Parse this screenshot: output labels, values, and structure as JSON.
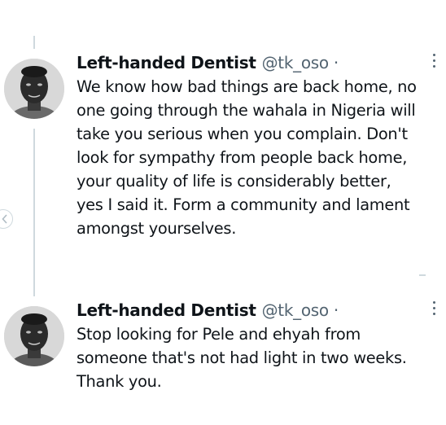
{
  "tweets": [
    {
      "author": "Left-handed Dentist",
      "handle": "@tk_oso",
      "separator": "·",
      "lines": [
        "We know how bad things are back home, no",
        "one going through the wahala in Nigeria will",
        "take you serious when you complain. Don't",
        "look for sympathy from people back home,",
        "your quality of life is considerably better,",
        "yes I said it. Form a community and lament",
        "amongst yourselves."
      ]
    },
    {
      "author": "Left-handed Dentist",
      "handle": "@tk_oso",
      "separator": "·",
      "lines": [
        "Stop looking for Pele and ehyah from",
        "someone that's not had light in two weeks.",
        "Thank you."
      ]
    }
  ],
  "icons": {
    "more": "more-options-icon",
    "side": "chevron-left-icon",
    "avatar": "profile-photo"
  },
  "colors": {
    "text": "#0f1419",
    "secondary": "#536471",
    "thread_line": "#cfd9de"
  }
}
